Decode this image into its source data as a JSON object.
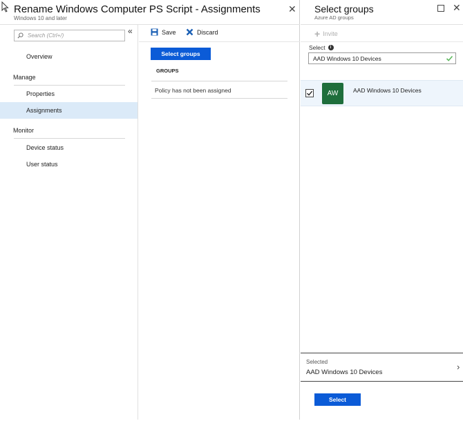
{
  "main_blade": {
    "title": "Rename Windows Computer PS Script - Assignments",
    "subtitle": "Windows 10 and later"
  },
  "sidebar": {
    "search_placeholder": "Search (Ctrl+/)",
    "overview": "Overview",
    "manage_heading": "Manage",
    "properties": "Properties",
    "assignments": "Assignments",
    "monitor_heading": "Monitor",
    "device_status": "Device status",
    "user_status": "User status"
  },
  "toolbar": {
    "save_label": "Save",
    "discard_label": "Discard"
  },
  "content": {
    "select_groups_label": "Select groups",
    "groups_header": "GROUPS",
    "empty_message": "Policy has not been assigned"
  },
  "select_blade": {
    "title": "Select groups",
    "subtitle": "Azure AD groups",
    "invite_label": "Invite",
    "select_label": "Select",
    "search_value": "AAD Windows 10 Devices",
    "result": {
      "initials": "AW",
      "name": "AAD Windows 10 Devices",
      "checked": true,
      "avatar_color": "#1e6e3c"
    },
    "selected_label": "Selected",
    "selected_value": "AAD Windows 10 Devices",
    "select_button": "Select"
  },
  "colors": {
    "accent": "#0b5bd7",
    "active_nav": "#dbeaf8",
    "valid_check": "#5cb85c"
  }
}
